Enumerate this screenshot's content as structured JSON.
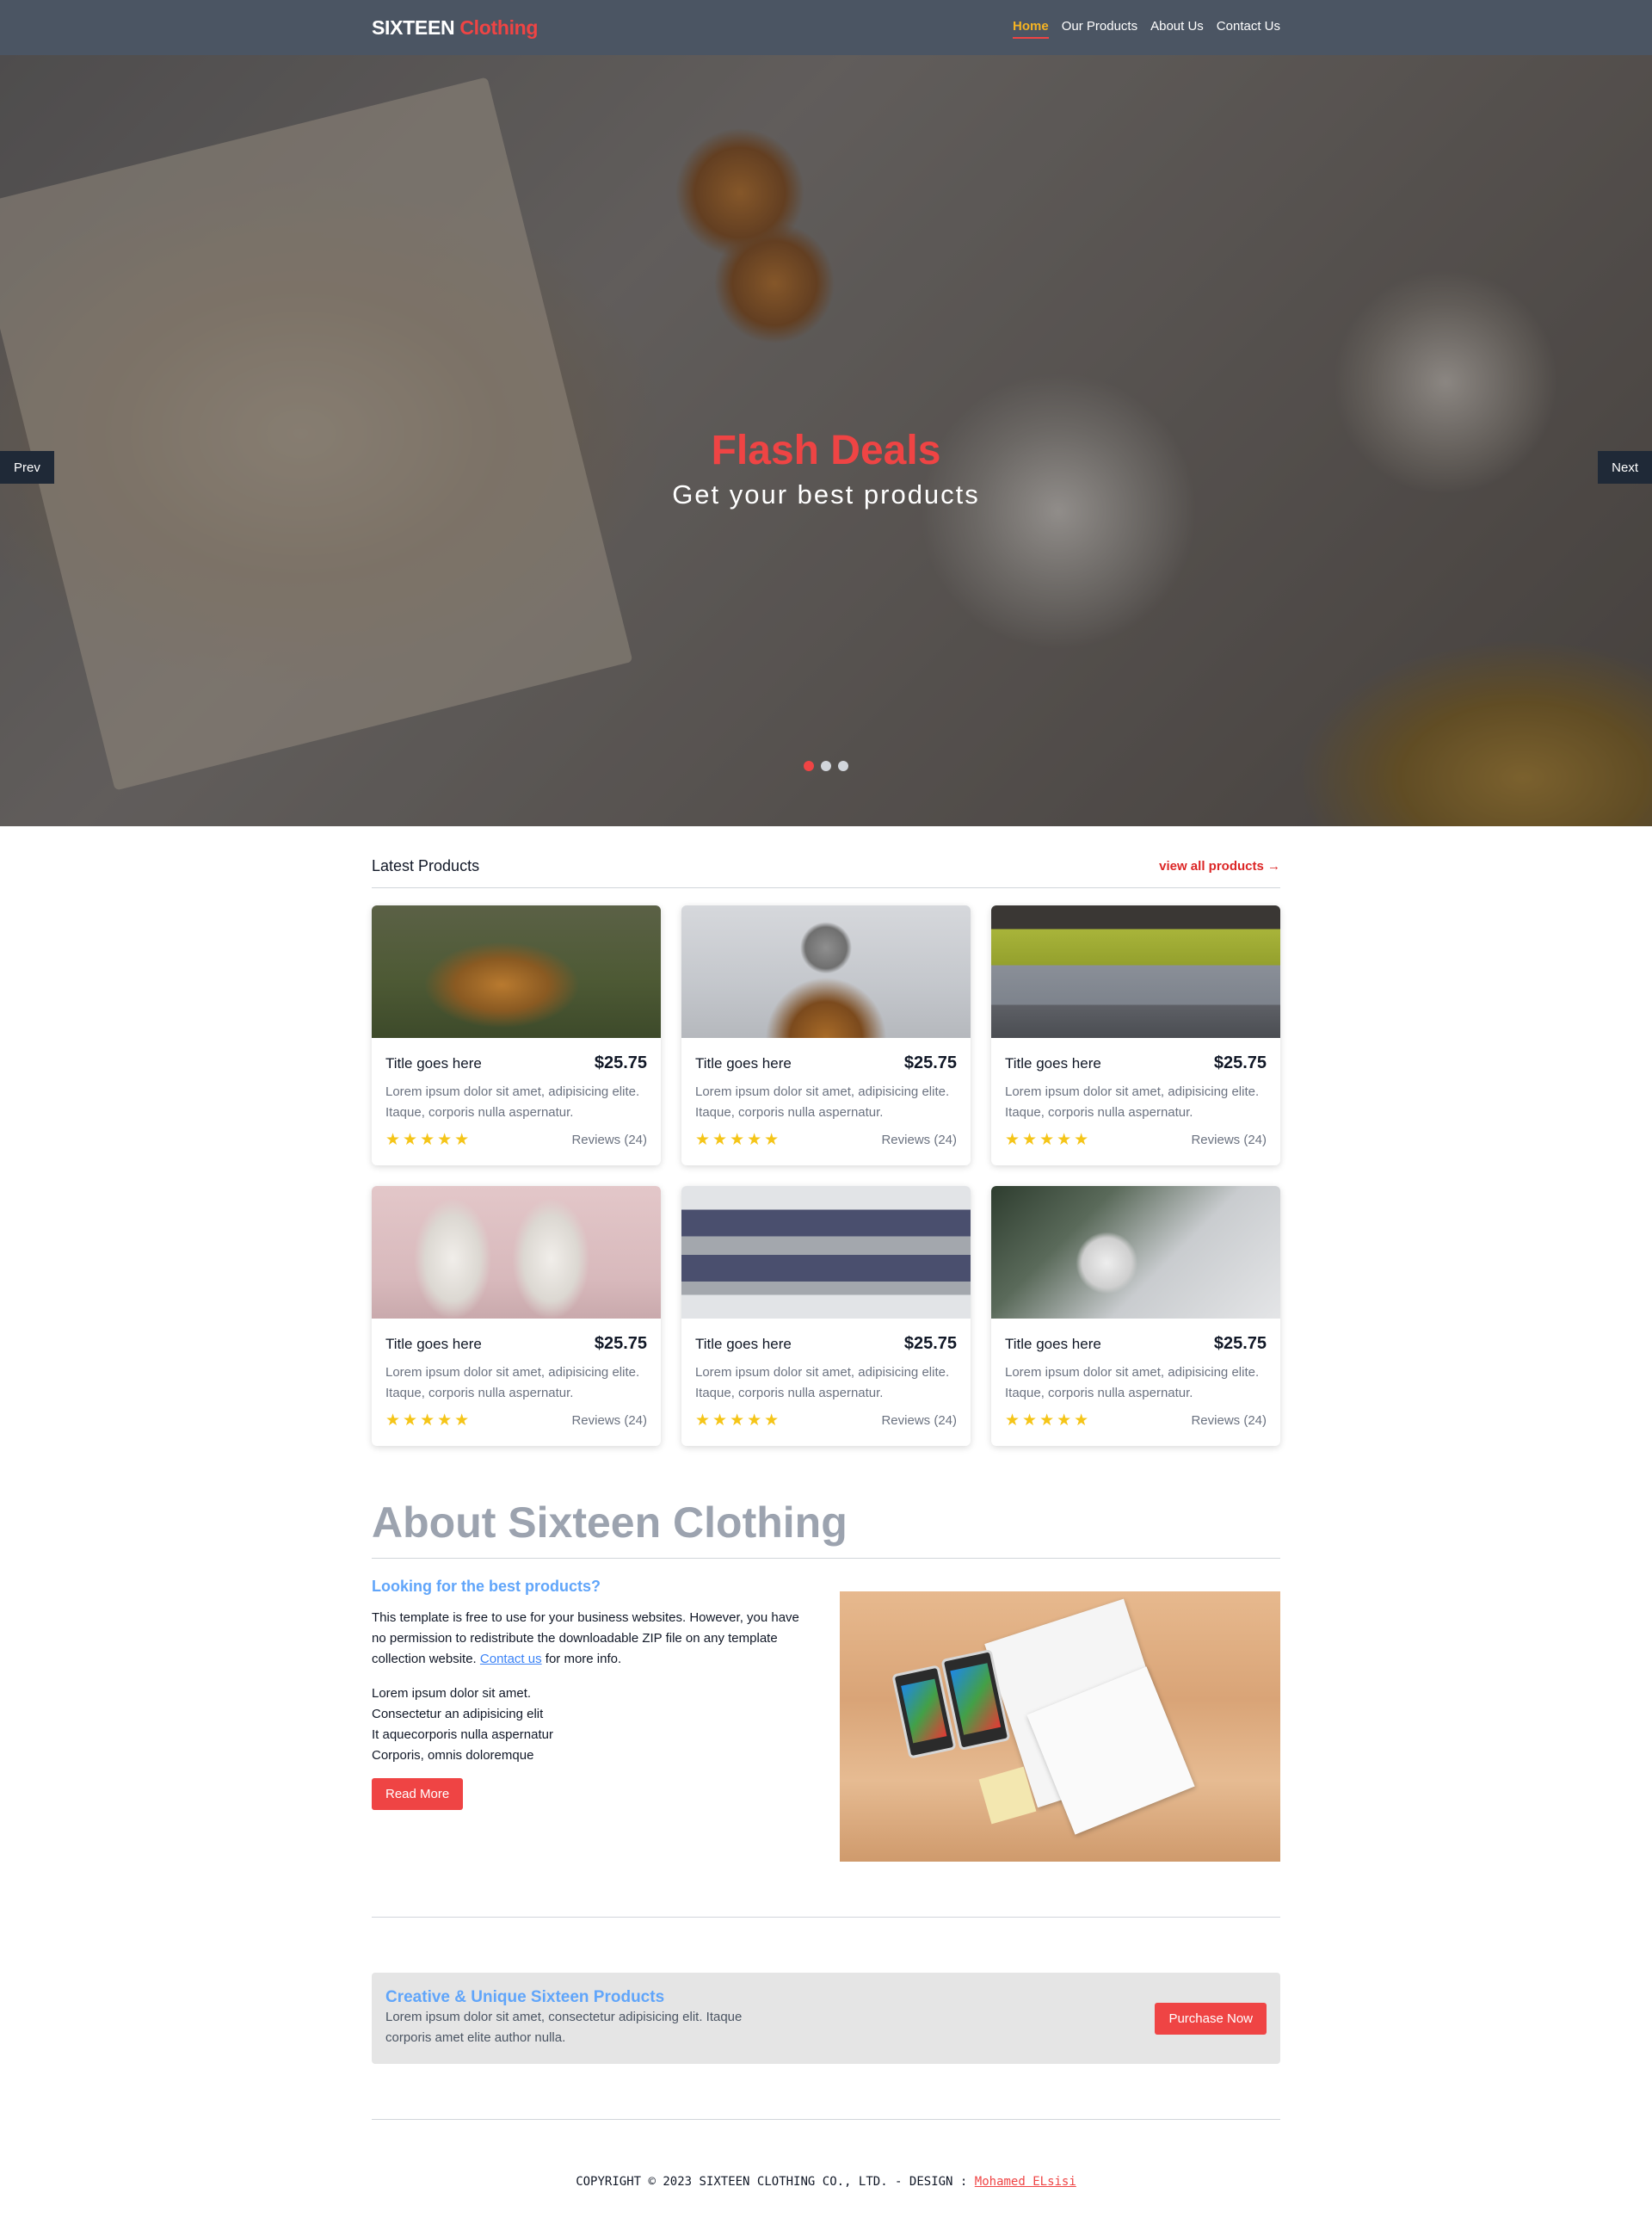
{
  "nav": {
    "brand": "SIXTEEN",
    "brand_accent": "Clothing",
    "items": [
      {
        "label": "Home",
        "active": true
      },
      {
        "label": "Our Products",
        "active": false
      },
      {
        "label": "About Us",
        "active": false
      },
      {
        "label": "Contact Us",
        "active": false
      }
    ]
  },
  "hero": {
    "title": "Flash Deals",
    "subtitle": "Get your best products",
    "prev_label": "Prev",
    "next_label": "Next",
    "slides": 3,
    "active_slide": 1
  },
  "latest": {
    "heading": "Latest Products",
    "view_all": "view all products",
    "products": [
      {
        "title": "Title goes here",
        "price": "$25.75",
        "description": "Lorem ipsum dolor sit amet, adipisicing elite. Itaque, corporis nulla aspernatur.",
        "rating": 5,
        "reviews": "Reviews (24)",
        "image": "boots-photo"
      },
      {
        "title": "Title goes here",
        "price": "$25.75",
        "description": "Lorem ipsum dolor sit amet, adipisicing elite. Itaque, corporis nulla aspernatur.",
        "rating": 5,
        "reviews": "Reviews (24)",
        "image": "beanie-jacket-photo"
      },
      {
        "title": "Title goes here",
        "price": "$25.75",
        "description": "Lorem ipsum dolor sit amet, adipisicing elite. Itaque, corporis nulla aspernatur.",
        "rating": 5,
        "reviews": "Reviews (24)",
        "image": "folded-sweaters-photo"
      },
      {
        "title": "Title goes here",
        "price": "$25.75",
        "description": "Lorem ipsum dolor sit amet, adipisicing elite. Itaque, corporis nulla aspernatur.",
        "rating": 5,
        "reviews": "Reviews (24)",
        "image": "sock-snowmen-photo"
      },
      {
        "title": "Title goes here",
        "price": "$25.75",
        "description": "Lorem ipsum dolor sit amet, adipisicing elite. Itaque, corporis nulla aspernatur.",
        "rating": 5,
        "reviews": "Reviews (24)",
        "image": "striped-sweater-photo"
      },
      {
        "title": "Title goes here",
        "price": "$25.75",
        "description": "Lorem ipsum dolor sit amet, adipisicing elite. Itaque, corporis nulla aspernatur.",
        "rating": 5,
        "reviews": "Reviews (24)",
        "image": "snowman-ornament-photo"
      }
    ]
  },
  "about": {
    "title": "About Sixteen Clothing",
    "subtitle": "Looking for the best products?",
    "paragraph_before_link": "This template is free to use for your business websites. However, you have no permission to redistribute the downloadable ZIP file on any template collection website. ",
    "paragraph_link": "Contact us",
    "paragraph_after_link": " for more info.",
    "list": [
      "Lorem ipsum dolor sit amet.",
      "Consectetur an adipisicing elit",
      "It aquecorporis nulla aspernatur",
      "Corporis, omnis doloremque"
    ],
    "button": "Read More"
  },
  "cta": {
    "title": "Creative & Unique Sixteen Products",
    "text": "Lorem ipsum dolor sit amet, consectetur adipisicing elit. Itaque corporis amet elite author nulla.",
    "button": "Purchase Now"
  },
  "footer": {
    "copyright": "COPYRIGHT © 2023 SIXTEEN CLOTHING CO., LTD. - DESIGN : ",
    "designer": "Mohamed ELsisi"
  },
  "colors": {
    "nav_bg": "#4b5563",
    "accent_red": "#ef4444",
    "active_nav": "#f5b323",
    "link_blue": "#60a5fa",
    "star": "#f5c518"
  }
}
